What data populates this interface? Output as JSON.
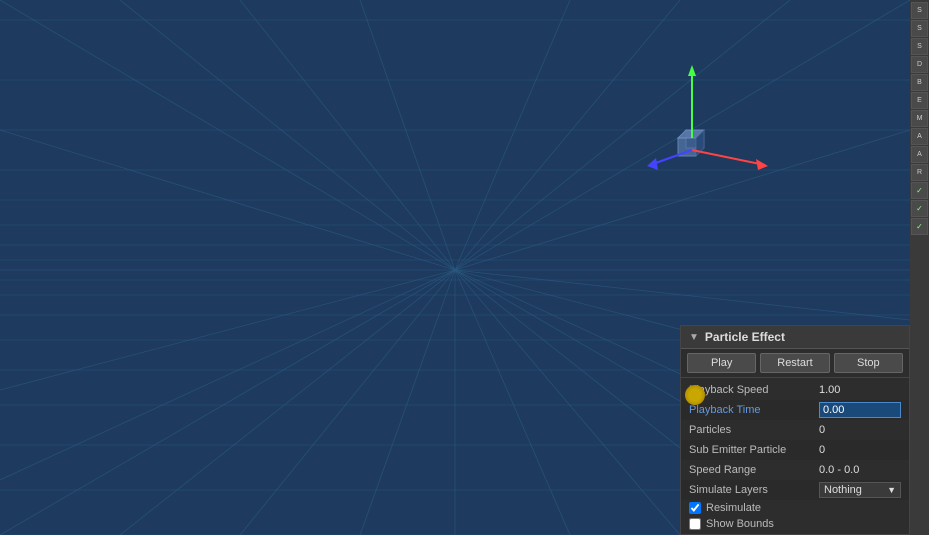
{
  "viewport": {
    "background_color": "#1e3a5f",
    "grid_color": "#2a5580"
  },
  "right_toolbar": {
    "items": [
      "S",
      "S",
      "S",
      "D",
      "B",
      "E",
      "M",
      "A",
      "A",
      "R",
      "✓",
      "✓",
      "✓"
    ]
  },
  "particle_panel": {
    "title": "Particle Effect",
    "arrow": "▼",
    "buttons": {
      "play": "Play",
      "restart": "Restart",
      "stop": "Stop"
    },
    "fields": {
      "playback_speed_label": "Playback Speed",
      "playback_speed_value": "1.00",
      "playback_time_label": "Playback Time",
      "playback_time_value": "0.00",
      "particles_label": "Particles",
      "particles_value": "0",
      "sub_emitter_label": "Sub Emitter Particle",
      "sub_emitter_value": "0",
      "speed_range_label": "Speed Range",
      "speed_range_value": "0.0 - 0.0",
      "simulate_layers_label": "Simulate Layers",
      "simulate_layers_value": "Nothing",
      "resimulate_label": "Resimulate",
      "resimulate_checked": true,
      "show_bounds_label": "Show Bounds"
    }
  }
}
